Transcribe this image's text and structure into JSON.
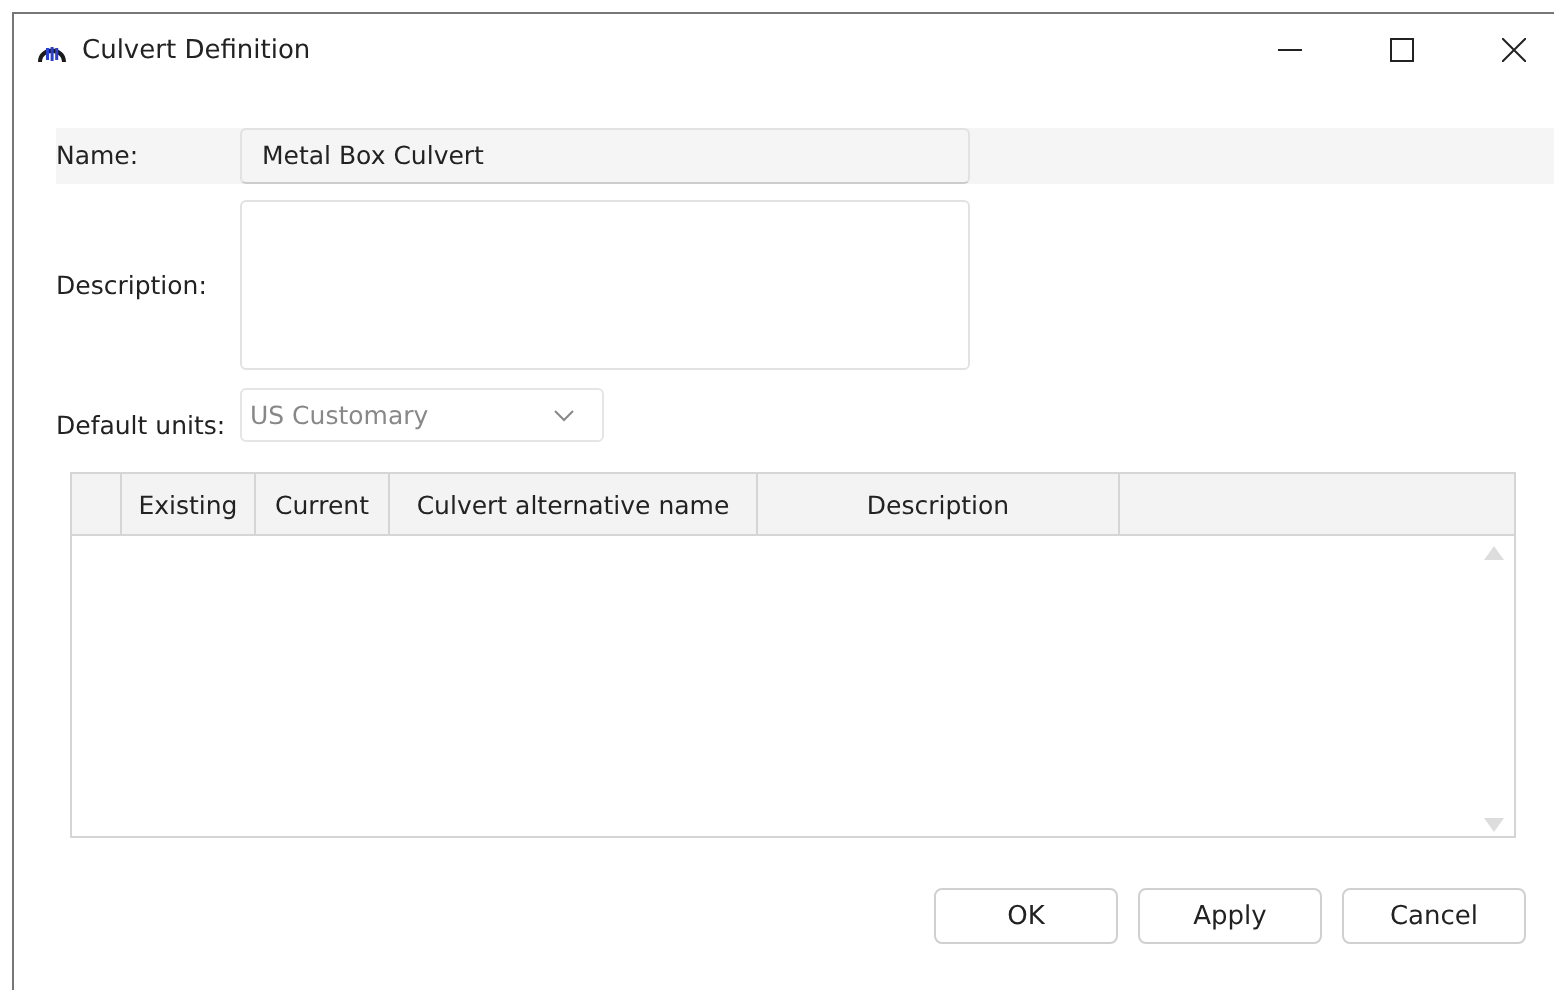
{
  "window": {
    "title": "Culvert Definition"
  },
  "fields": [
    {
      "label": "Name:",
      "value": "Metal Box Culvert",
      "kind": "line"
    },
    {
      "label": "Description:",
      "kind": "area"
    }
  ],
  "default_units": {
    "label": "Default units:",
    "value": "US Customary",
    "disabled": true
  },
  "table": {
    "columns": [
      "Existing",
      "Current",
      "Culvert alternative name",
      "Description"
    ]
  },
  "buttons": [
    "OK",
    "Apply",
    "Cancel"
  ]
}
